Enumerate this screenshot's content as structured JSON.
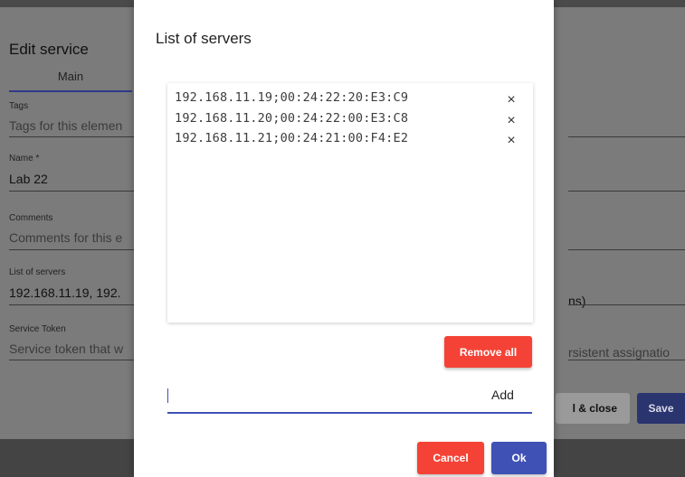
{
  "background_form": {
    "title": "Edit service",
    "tab_main": "Main",
    "tags_label": "Tags",
    "tags_placeholder": "Tags for this elemen",
    "name_label": "Name *",
    "name_value": "Lab 22",
    "comments_label": "Comments",
    "comments_placeholder": "Comments for this e",
    "servers_label": "List of servers",
    "servers_value": "192.168.11.19, 192.",
    "token_label": "Service Token",
    "token_placeholder": "Service token that w",
    "right_servers_suffix": "ns)",
    "right_token_suffix": "rsistent assignatio",
    "save_close_label": "l & close",
    "save_label": "Save"
  },
  "dialog": {
    "title": "List of servers",
    "servers": [
      "192.168.11.19;00:24:22:20:E3:C9",
      "192.168.11.20;00:24:22:00:E3:C8",
      "192.168.11.21;00:24:21:00:F4:E2"
    ],
    "remove_icon": "×",
    "remove_all_label": "Remove all",
    "add_input_value": "",
    "add_label": "Add",
    "cancel_label": "Cancel",
    "ok_label": "Ok"
  },
  "colors": {
    "primary": "#3f51b5",
    "danger": "#f44336"
  }
}
